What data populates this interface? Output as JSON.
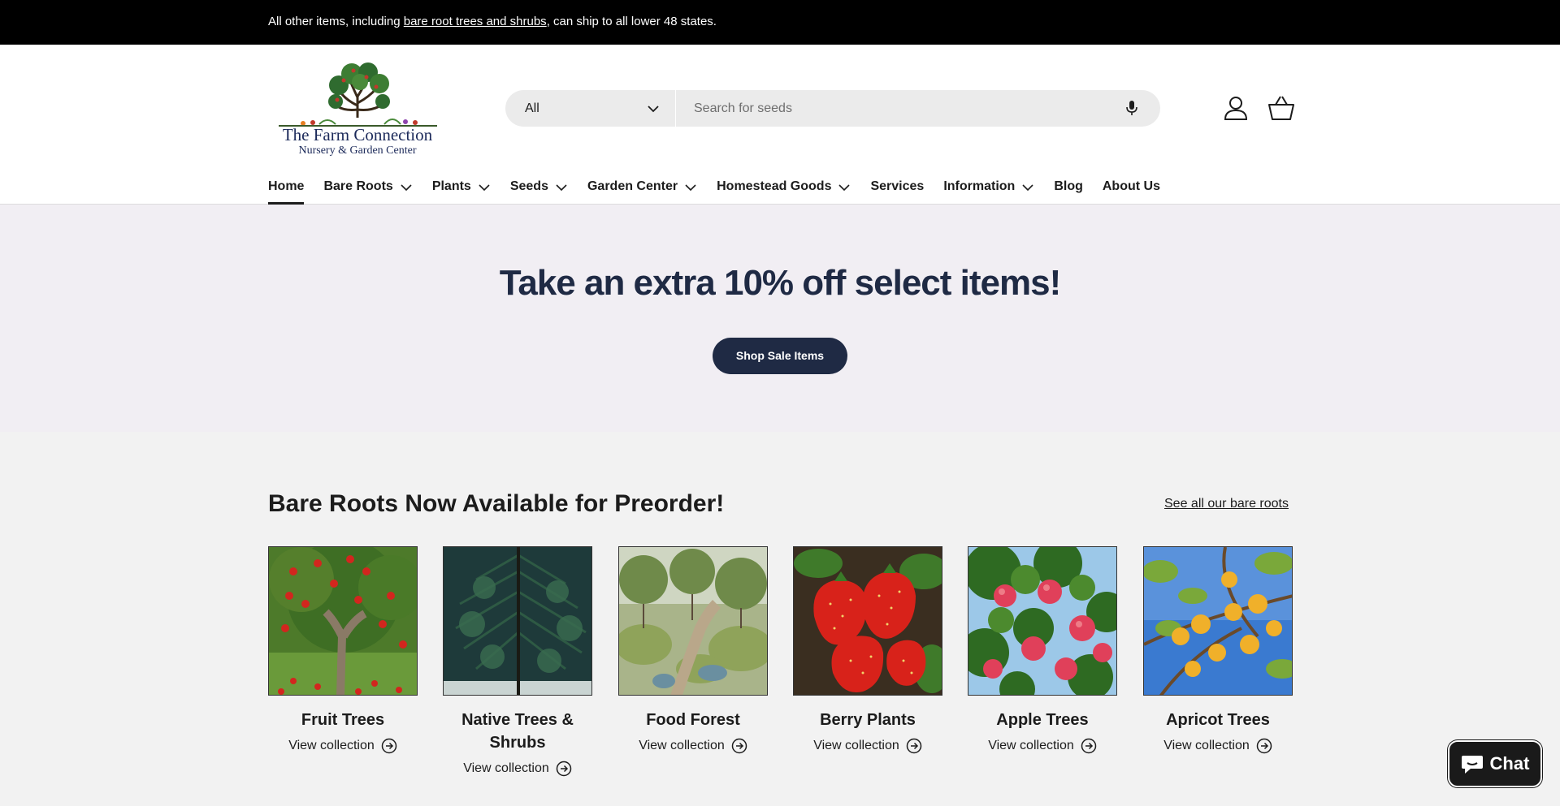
{
  "announcement": {
    "prefix": "All other items, including ",
    "link": "bare root trees and shrubs",
    "suffix": ", can ship to all lower 48 states."
  },
  "logo": {
    "name_line1": "The Farm Connection",
    "name_line2": "Nursery & Garden Center"
  },
  "search": {
    "category": "All",
    "placeholder": "Search for seeds"
  },
  "nav": {
    "items": [
      {
        "label": "Home"
      },
      {
        "label": "Bare Roots"
      },
      {
        "label": "Plants"
      },
      {
        "label": "Seeds"
      },
      {
        "label": "Garden Center"
      },
      {
        "label": "Homestead Goods"
      },
      {
        "label": "Services"
      },
      {
        "label": "Information"
      },
      {
        "label": "Blog"
      },
      {
        "label": "About Us"
      }
    ]
  },
  "hero": {
    "headline": "Take an extra 10% off select items!",
    "button": "Shop Sale Items"
  },
  "collections": {
    "heading": "Bare Roots Now Available for Preorder!",
    "see_all": "See all our bare roots",
    "view_label": "View collection",
    "items": [
      {
        "title": "Fruit Trees"
      },
      {
        "title": "Native Trees & Shrubs"
      },
      {
        "title": "Food Forest"
      },
      {
        "title": "Berry Plants"
      },
      {
        "title": "Apple Trees"
      },
      {
        "title": "Apricot Trees"
      }
    ]
  },
  "chat": {
    "label": "Chat"
  },
  "colors": {
    "hero_bg": "#f1eef3",
    "brand_navy": "#1f2a44",
    "announce_bg": "#000000"
  }
}
